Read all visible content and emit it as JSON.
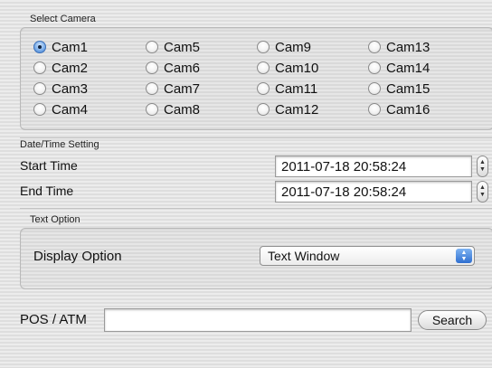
{
  "select_camera": {
    "title": "Select Camera",
    "selected": "Cam1",
    "columns": [
      [
        "Cam1",
        "Cam2",
        "Cam3",
        "Cam4"
      ],
      [
        "Cam5",
        "Cam6",
        "Cam7",
        "Cam8"
      ],
      [
        "Cam9",
        "Cam10",
        "Cam11",
        "Cam12"
      ],
      [
        "Cam13",
        "Cam14",
        "Cam15",
        "Cam16"
      ]
    ]
  },
  "datetime": {
    "title": "Date/Time Setting",
    "start_label": "Start Time",
    "start_value": "2011-07-18 20:58:24",
    "end_label": "End Time",
    "end_value": "2011-07-18 20:58:24"
  },
  "text_option": {
    "title": "Text Option",
    "display_label": "Display Option",
    "display_value": "Text Window"
  },
  "pos": {
    "label": "POS / ATM",
    "input_value": "",
    "search_label": "Search"
  },
  "colors": {
    "accent": "#3f7ed0"
  }
}
